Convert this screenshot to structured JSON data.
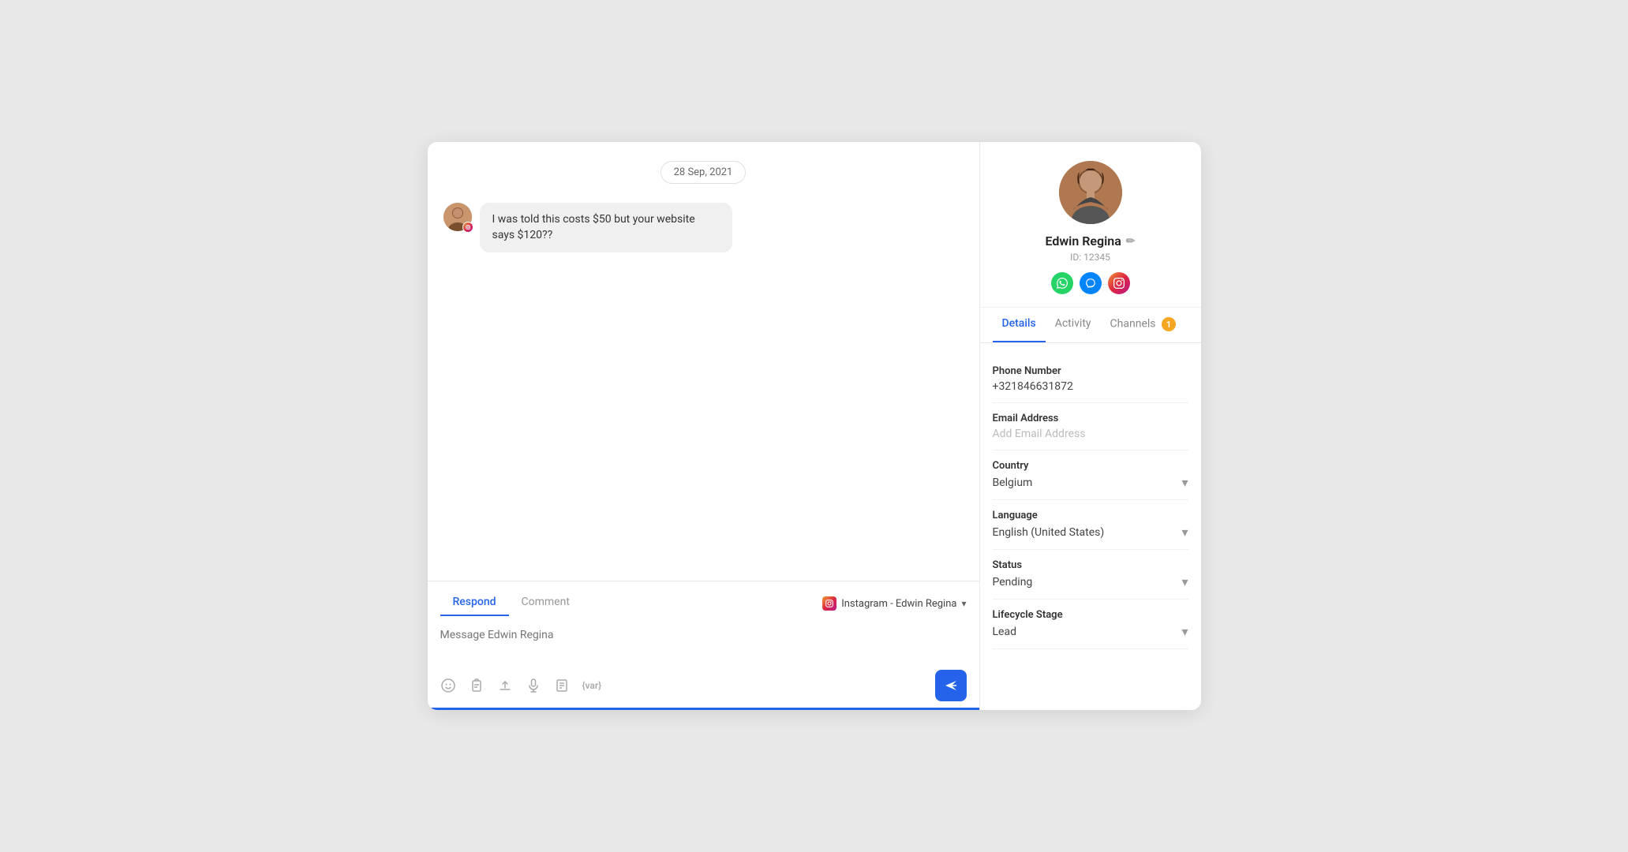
{
  "chat": {
    "date_badge": "28 Sep, 2021",
    "message": "I was told this costs $50 but your website says $120??",
    "compose_tab_respond": "Respond",
    "compose_tab_comment": "Comment",
    "channel_label": "Instagram - Edwin Regina",
    "input_placeholder": "Message Edwin Regina"
  },
  "profile": {
    "name": "Edwin Regina",
    "id_label": "ID: 12345",
    "tabs": [
      {
        "label": "Details",
        "active": true
      },
      {
        "label": "Activity",
        "active": false
      },
      {
        "label": "Channels",
        "active": false,
        "badge": "1"
      }
    ],
    "fields": [
      {
        "label": "Phone Number",
        "value": "+321846631872",
        "type": "text"
      },
      {
        "label": "Email Address",
        "value": "",
        "placeholder": "Add Email Address",
        "type": "text"
      },
      {
        "label": "Country",
        "value": "Belgium",
        "type": "select"
      },
      {
        "label": "Language",
        "value": "English (United States)",
        "type": "select"
      },
      {
        "label": "Status",
        "value": "Pending",
        "type": "select"
      },
      {
        "label": "Lifecycle Stage",
        "value": "Lead",
        "type": "select"
      }
    ]
  },
  "toolbar_icons": [
    {
      "name": "emoji-icon",
      "glyph": "☺"
    },
    {
      "name": "clipboard-icon",
      "glyph": "📋"
    },
    {
      "name": "upload-icon",
      "glyph": "⬆"
    },
    {
      "name": "microphone-icon",
      "glyph": "🎤"
    },
    {
      "name": "note-icon",
      "glyph": "📄"
    },
    {
      "name": "variable-icon",
      "glyph": "{var}"
    }
  ]
}
